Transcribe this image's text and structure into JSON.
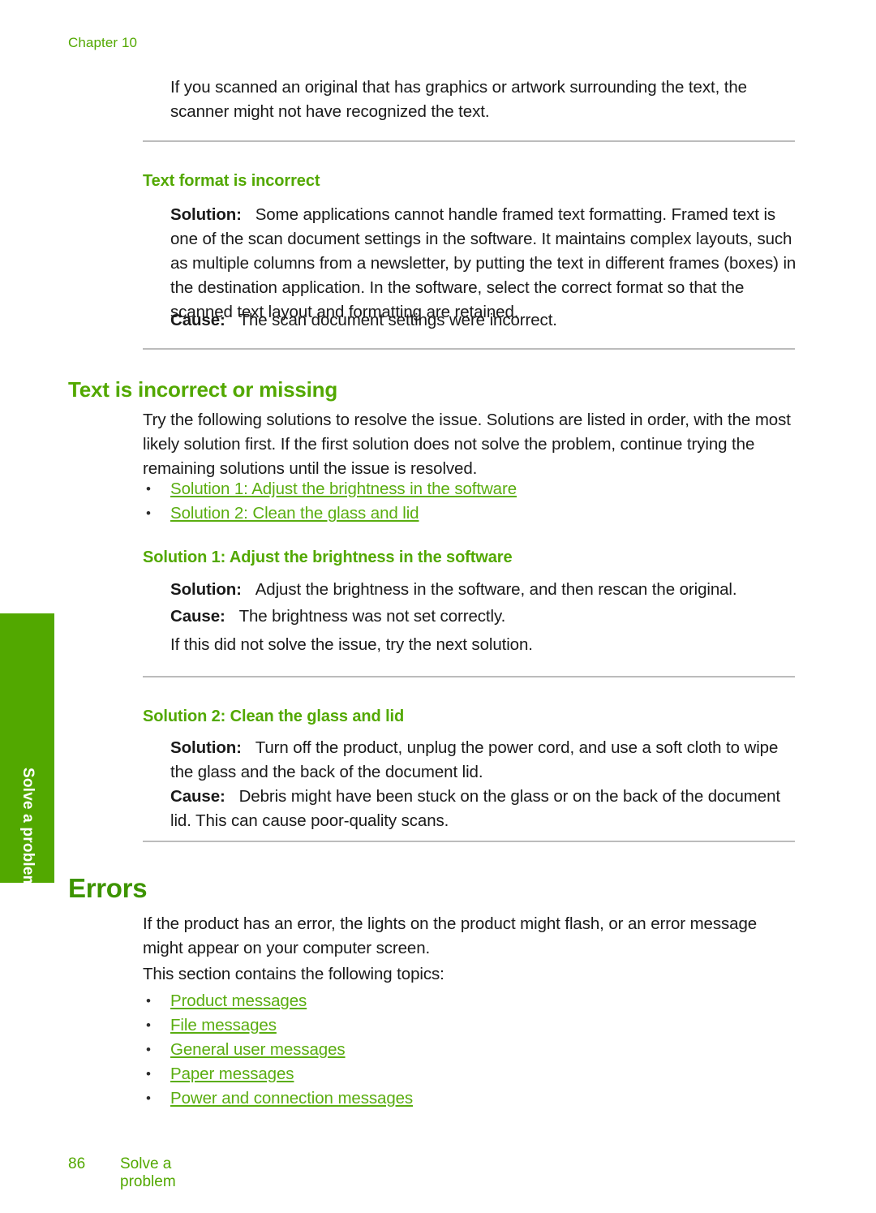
{
  "page": {
    "chapter_label": "Chapter 10",
    "footer_page_number": "86",
    "footer_section": "Solve a problem",
    "side_tab_label": "Solve a problem",
    "accent_green": "#52a800",
    "link_green": "#5aad10",
    "heading_green": "#3d9400",
    "rule_gray": "#bcbcbc",
    "body_color": "#1a1a1a"
  },
  "intro_paragraph": "If you scanned an original that has graphics or artwork surrounding the text, the scanner might not have recognized the text.",
  "text_format_section": {
    "heading": "Text format is incorrect",
    "solution_label": "Solution:",
    "solution_text": "Some applications cannot handle framed text formatting. Framed text is one of the scan document settings in the software. It maintains complex layouts, such as multiple columns from a newsletter, by putting the text in different frames (boxes) in the destination application. In the software, select the correct format so that the scanned text layout and formatting are retained.",
    "cause_label": "Cause:",
    "cause_text": "The scan document settings were incorrect."
  },
  "text_incorrect_section": {
    "heading": "Text is incorrect or missing",
    "intro": "Try the following solutions to resolve the issue. Solutions are listed in order, with the most likely solution first. If the first solution does not solve the problem, continue trying the remaining solutions until the issue is resolved.",
    "links": [
      {
        "bullet": "•",
        "label": "Solution 1: Adjust the brightness in the software"
      },
      {
        "bullet": "•",
        "label": "Solution 2: Clean the glass and lid"
      }
    ],
    "solution1": {
      "heading": "Solution 1: Adjust the brightness in the software",
      "solution_label": "Solution:",
      "solution_text": "Adjust the brightness in the software, and then rescan the original.",
      "cause_label": "Cause:",
      "cause_text": "The brightness was not set correctly.",
      "next_text": "If this did not solve the issue, try the next solution."
    },
    "solution2": {
      "heading": "Solution 2: Clean the glass and lid",
      "solution_label": "Solution:",
      "solution_text": "Turn off the product, unplug the power cord, and use a soft cloth to wipe the glass and the back of the document lid.",
      "cause_label": "Cause:",
      "cause_text": "Debris might have been stuck on the glass or on the back of the document lid. This can cause poor-quality scans."
    }
  },
  "errors_section": {
    "heading": "Errors",
    "paragraph1": "If the product has an error, the lights on the product might flash, or an error message might appear on your computer screen.",
    "paragraph2": "This section contains the following topics:",
    "links": [
      {
        "bullet": "•",
        "label": "Product messages"
      },
      {
        "bullet": "•",
        "label": "File messages"
      },
      {
        "bullet": "•",
        "label": "General user messages"
      },
      {
        "bullet": "•",
        "label": "Paper messages"
      },
      {
        "bullet": "•",
        "label": "Power and connection messages"
      }
    ]
  }
}
